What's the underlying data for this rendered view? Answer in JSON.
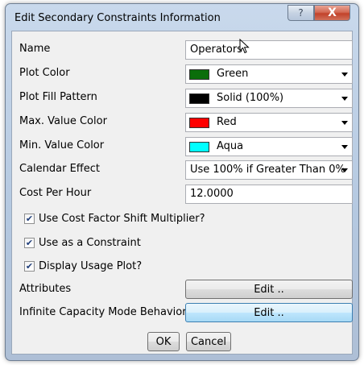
{
  "window": {
    "title": "Edit Secondary Constraints Information",
    "help_glyph": "?",
    "close_glyph": "X"
  },
  "fields": {
    "name": {
      "label": "Name",
      "value": "Operators"
    },
    "plot_color": {
      "label": "Plot Color",
      "value": "Green",
      "swatch": "#0a6e0a"
    },
    "plot_fill_pattern": {
      "label": "Plot Fill Pattern",
      "value": "Solid (100%)",
      "swatch": "#000000"
    },
    "max_value_color": {
      "label": "Max. Value Color",
      "value": "Red",
      "swatch": "#ff0000"
    },
    "min_value_color": {
      "label": "Min. Value Color",
      "value": "Aqua",
      "swatch": "#00ffff"
    },
    "calendar_effect": {
      "label": "Calendar Effect",
      "value": "Use 100% if Greater Than 0%"
    },
    "cost_per_hour": {
      "label": "Cost Per Hour",
      "value": "12.0000"
    }
  },
  "checkboxes": [
    {
      "label": "Use Cost Factor Shift Multiplier?",
      "checked": true,
      "mark": "✔"
    },
    {
      "label": "Use as a Constraint",
      "checked": true,
      "mark": "✔"
    },
    {
      "label": "Display Usage Plot?",
      "checked": true,
      "mark": "✔"
    }
  ],
  "attributes": {
    "label": "Attributes",
    "button": "Edit .."
  },
  "infinite_capacity": {
    "label": "Infinite Capacity Mode Behavior",
    "button": "Edit .."
  },
  "footer": {
    "ok": "OK",
    "cancel": "Cancel"
  }
}
